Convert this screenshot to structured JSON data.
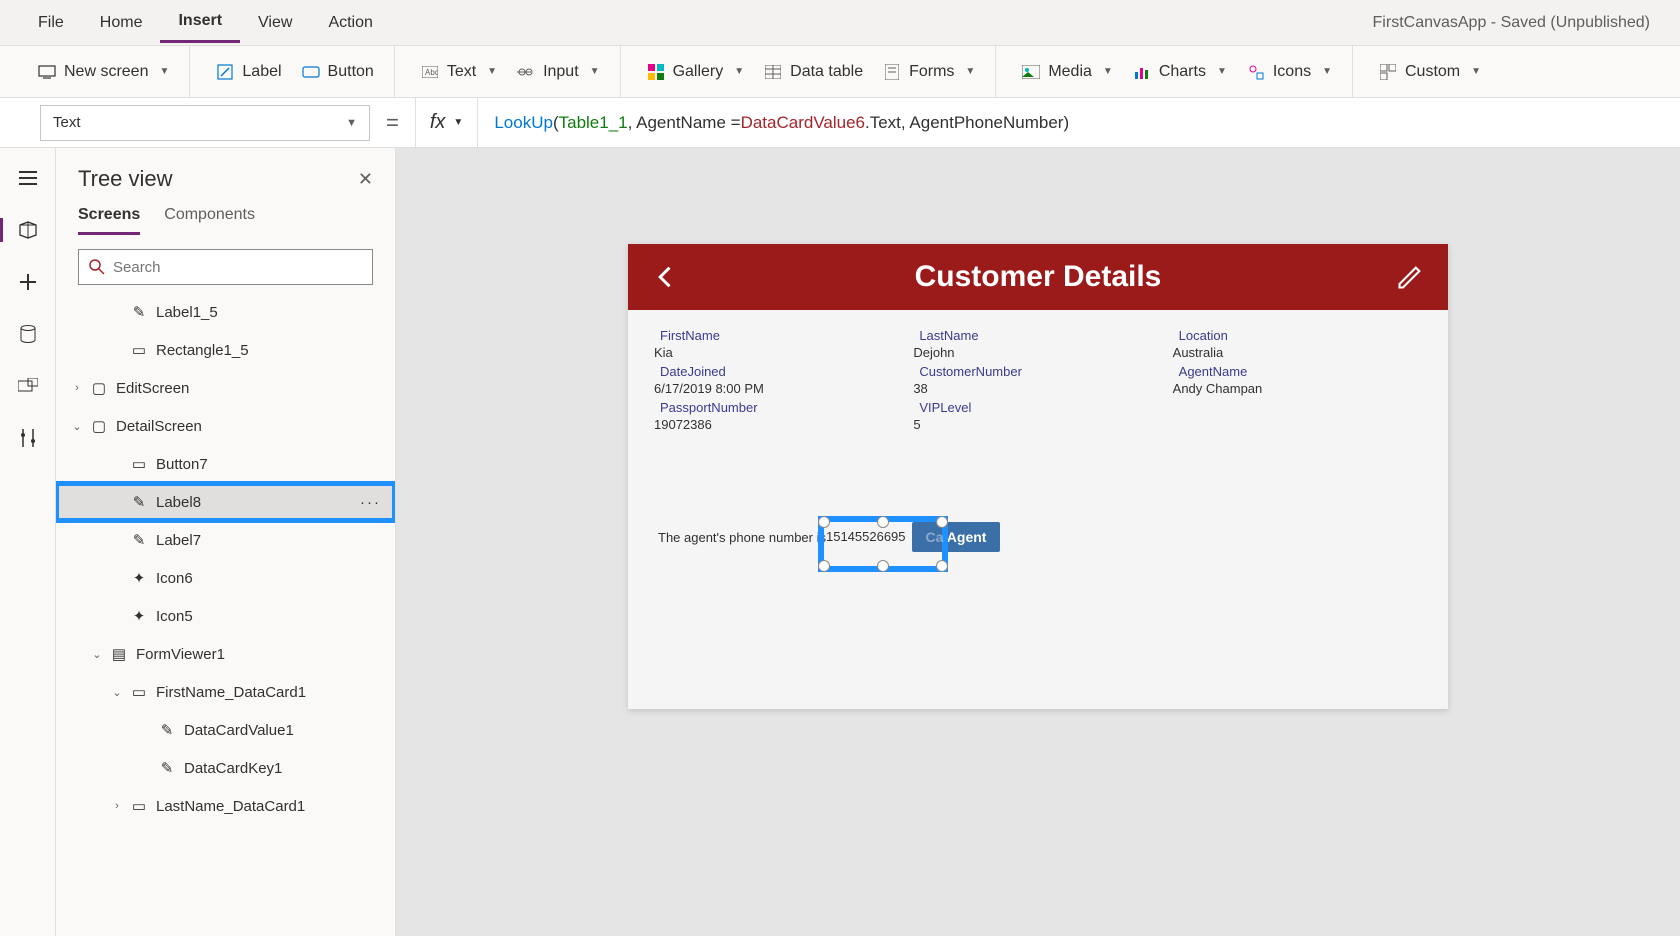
{
  "app": {
    "title": "FirstCanvasApp - Saved (Unpublished)"
  },
  "menubar": {
    "file": "File",
    "home": "Home",
    "insert": "Insert",
    "view": "View",
    "action": "Action"
  },
  "ribbon": {
    "new_screen": "New screen",
    "label": "Label",
    "button": "Button",
    "text": "Text",
    "input": "Input",
    "gallery": "Gallery",
    "data_table": "Data table",
    "forms": "Forms",
    "media": "Media",
    "charts": "Charts",
    "icons": "Icons",
    "custom": "Custom"
  },
  "formula_bar": {
    "property": "Text",
    "fx_label": "fx",
    "tokens": {
      "fn": "LookUp",
      "open": "(",
      "table": "Table1_1",
      "sep1": ", AgentName = ",
      "ref": "DataCardValue6",
      "tail": ".Text, AgentPhoneNumber)"
    }
  },
  "tree": {
    "title": "Tree view",
    "tab_screens": "Screens",
    "tab_components": "Components",
    "search_placeholder": "Search",
    "nodes": {
      "label1_5": "Label1_5",
      "rectangle1_5": "Rectangle1_5",
      "editscreen": "EditScreen",
      "detailscreen": "DetailScreen",
      "button7": "Button7",
      "label8": "Label8",
      "label7": "Label7",
      "icon6": "Icon6",
      "icon5": "Icon5",
      "formviewer1": "FormViewer1",
      "firstname_dc": "FirstName_DataCard1",
      "datacardvalue1": "DataCardValue1",
      "datacardkey1": "DataCardKey1",
      "lastname_dc": "LastName_DataCard1"
    }
  },
  "screen": {
    "header_title": "Customer Details",
    "fields": {
      "firstname_l": "FirstName",
      "firstname_v": "Kia",
      "lastname_l": "LastName",
      "lastname_v": "Dejohn",
      "location_l": "Location",
      "location_v": "Australia",
      "datejoined_l": "DateJoined",
      "datejoined_v": "6/17/2019 8:00 PM",
      "custnum_l": "CustomerNumber",
      "custnum_v": "38",
      "agentname_l": "AgentName",
      "agentname_v": "Andy Champan",
      "passport_l": "PassportNumber",
      "passport_v": "19072386",
      "vip_l": "VIPLevel",
      "vip_v": "5"
    },
    "agent_phone_prefix": "The agent's phone number is ",
    "agent_phone_value": "15145526695",
    "call_button": "Agent",
    "call_button_prefix": "Ca"
  }
}
